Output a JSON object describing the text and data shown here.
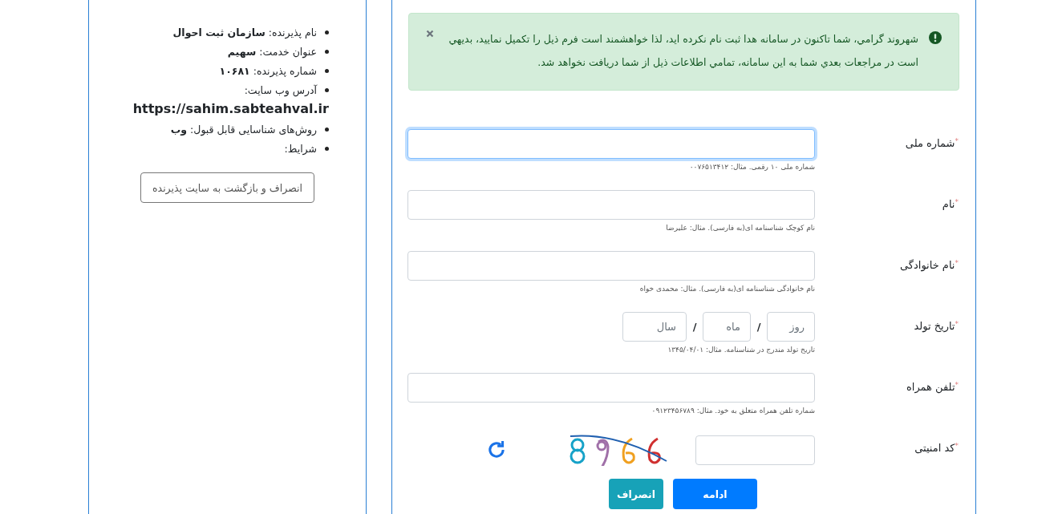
{
  "info": {
    "items": [
      {
        "kind": "text",
        "text": "نام پذیرنده: **سازمان ثبت احوال**"
      },
      {
        "kind": "text",
        "text": "عنوان خدمت: **سهیم**"
      },
      {
        "kind": "text",
        "text": "شماره پذیرنده: **۱۰۶۸۱**"
      },
      {
        "kind": "url",
        "text": "آدرس وب سایت:",
        "url": "https://sahim.sabteahval.ir"
      },
      {
        "kind": "text",
        "text": "روش‌های شناسایی قابل قبول: **وب**"
      },
      {
        "kind": "text",
        "text": "شرایط:"
      }
    ],
    "button": "انصراف و بازگشت به سایت پذیرنده"
  },
  "alert": {
    "text": "شهروند گرامي، شما تاکنون در سامانه هدا ثبت نام نکرده ايد، لذا خواهشمند است فرم ذيل را تکميل نماييد، بديهي است در مراجعات بعدي شما به اين سامانه، تمامي اطلاعات ذيل از شما دريافت نخواهد شد."
  },
  "form": {
    "required_mark": "*",
    "fields": [
      {
        "kind": "text",
        "label": "شماره ملی",
        "focused": true,
        "hint": "شماره ملی ۱۰ رقمی. مثال: ۰۰۷۶۵۱۳۴۱۲"
      },
      {
        "kind": "text",
        "label": "نام",
        "focused": false,
        "hint": "نام کوچک شناسنامه ای(به فارسی). مثال: علیرضا"
      },
      {
        "kind": "text",
        "label": "نام خانوادگی",
        "focused": false,
        "hint": "نام خانوادگی شناسنامه ای(به فارسی). مثال: محمدی خواه"
      },
      {
        "kind": "date",
        "label": "تاریخ تولد",
        "focused": false,
        "separator": "/",
        "parts": [
          {
            "placeholder": "روز"
          },
          {
            "placeholder": "ماه"
          },
          {
            "placeholder": "سال"
          }
        ],
        "hint": "تاریخ تولد مندرج در شناسنامه. مثال: ۱۳۴۵/۰۴/۰۱"
      },
      {
        "kind": "text",
        "label": "تلفن همراه",
        "focused": false,
        "hint": "شماره تلفن همراه متعلق به خود. مثال: ۰۹۱۲۳۴۵۶۷۸۹"
      },
      {
        "kind": "captcha",
        "label": "کد امنیتی",
        "focused": false
      }
    ],
    "buttons": [
      {
        "kind": "primary",
        "label": "ادامه"
      },
      {
        "kind": "secondary",
        "label": "انصراف"
      }
    ]
  }
}
